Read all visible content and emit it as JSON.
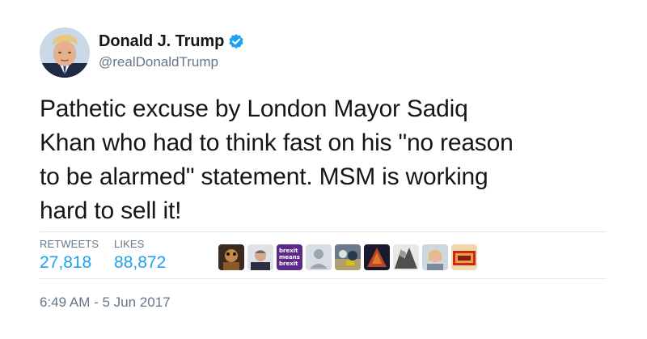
{
  "author": {
    "display_name": "Donald J. Trump",
    "handle": "@realDonaldTrump",
    "verified": true,
    "verified_icon": "verified-badge-icon",
    "verified_color": "#1da1f2"
  },
  "tweet": {
    "text": "Pathetic excuse by London Mayor Sadiq\nKhan who had to think fast on his \"no reason\nto be alarmed\" statement. MSM is working\nhard to sell it!"
  },
  "stats": {
    "retweets_label": "RETWEETS",
    "retweets_value": "27,818",
    "likes_label": "LIKES",
    "likes_value": "88,872",
    "accent_color": "#1da1f2"
  },
  "likers": [
    {
      "icon": "liker-avatar-1"
    },
    {
      "icon": "liker-avatar-2"
    },
    {
      "icon": "liker-avatar-3",
      "text_lines": [
        "brexit",
        "means",
        "brexit"
      ]
    },
    {
      "icon": "liker-avatar-4"
    },
    {
      "icon": "liker-avatar-5"
    },
    {
      "icon": "liker-avatar-6"
    },
    {
      "icon": "liker-avatar-7"
    },
    {
      "icon": "liker-avatar-8"
    },
    {
      "icon": "liker-avatar-9"
    }
  ],
  "timestamp": "6:49 AM - 5 Jun 2017"
}
